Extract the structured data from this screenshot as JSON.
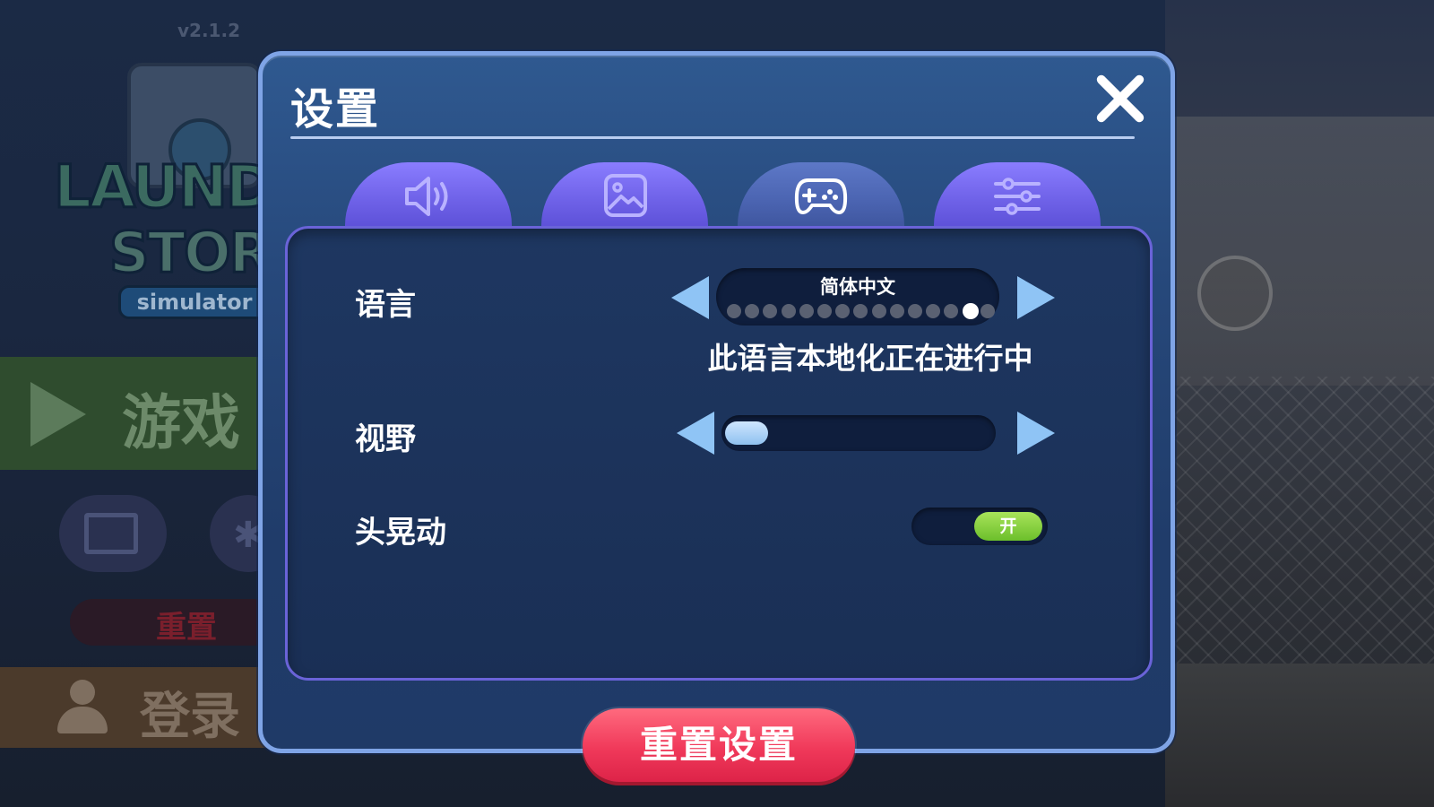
{
  "background": {
    "version": "v2.1.2",
    "logo": {
      "line1": "LAUND",
      "line2": "STOR",
      "sub": "simulator"
    },
    "menu": {
      "play_label": "游戏",
      "reset_label": "重置",
      "login_label": "登录"
    }
  },
  "dialog": {
    "title": "设置",
    "tabs": [
      {
        "icon": "speaker-icon",
        "active": false
      },
      {
        "icon": "image-icon",
        "active": false
      },
      {
        "icon": "gamepad-icon",
        "active": true
      },
      {
        "icon": "sliders-icon",
        "active": false
      }
    ],
    "settings": {
      "language": {
        "label": "语言",
        "value": "简体中文",
        "option_count": 15,
        "selected_index": 13,
        "notice": "此语言本地化正在进行中"
      },
      "fov": {
        "label": "视野",
        "level": 0.0
      },
      "head_bob": {
        "label": "头晃动",
        "state": "开"
      }
    },
    "reset_button": "重置设置"
  },
  "colors": {
    "dialog_border": "#7fa4e6",
    "tab": "#7b6ff5",
    "arrow": "#8fc4f5",
    "toggle_on": "#8fd443",
    "reset": "#f0395a"
  }
}
